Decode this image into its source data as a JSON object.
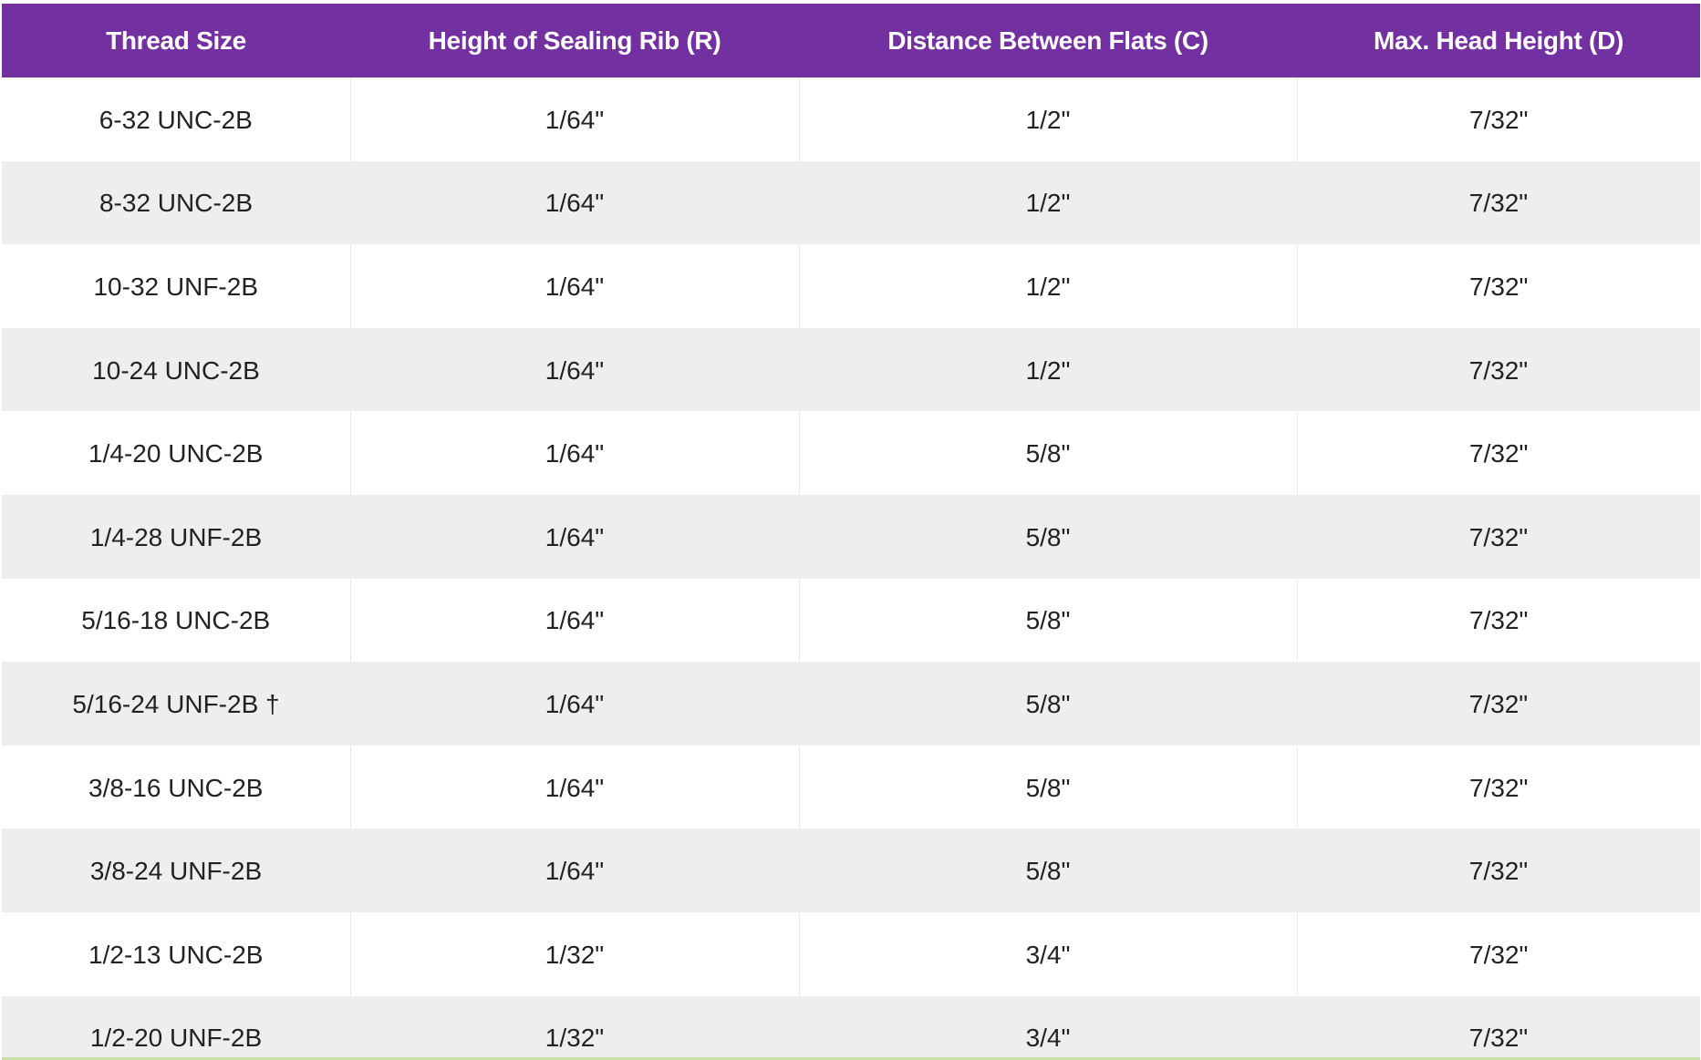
{
  "table": {
    "headers": [
      "Thread Size",
      "Height of Sealing Rib (R)",
      "Distance Between Flats (C)",
      "Max. Head Height (D)"
    ],
    "rows": [
      [
        "6-32 UNC-2B",
        "1/64\"",
        "1/2\"",
        "7/32\""
      ],
      [
        "8-32 UNC-2B",
        "1/64\"",
        "1/2\"",
        "7/32\""
      ],
      [
        "10-32 UNF-2B",
        "1/64\"",
        "1/2\"",
        "7/32\""
      ],
      [
        "10-24 UNC-2B",
        "1/64\"",
        "1/2\"",
        "7/32\""
      ],
      [
        "1/4-20 UNC-2B",
        "1/64\"",
        "5/8\"",
        "7/32\""
      ],
      [
        "1/4-28 UNF-2B",
        "1/64\"",
        "5/8\"",
        "7/32\""
      ],
      [
        "5/16-18 UNC-2B",
        "1/64\"",
        "5/8\"",
        "7/32\""
      ],
      [
        "5/16-24 UNF-2B †",
        "1/64\"",
        "5/8\"",
        "7/32\""
      ],
      [
        "3/8-16 UNC-2B",
        "1/64\"",
        "5/8\"",
        "7/32\""
      ],
      [
        "3/8-24 UNF-2B",
        "1/64\"",
        "5/8\"",
        "7/32\""
      ],
      [
        "1/2-13 UNC-2B",
        "1/32\"",
        "3/4\"",
        "7/32\""
      ],
      [
        "1/2-20 UNF-2B",
        "1/32\"",
        "3/4\"",
        "7/32\""
      ]
    ]
  },
  "colors": {
    "header_bg": "#7330a0",
    "header_text": "#ffffff",
    "stripe_bg": "#eeeeee",
    "bottom_accent": "#c8dfa8"
  }
}
